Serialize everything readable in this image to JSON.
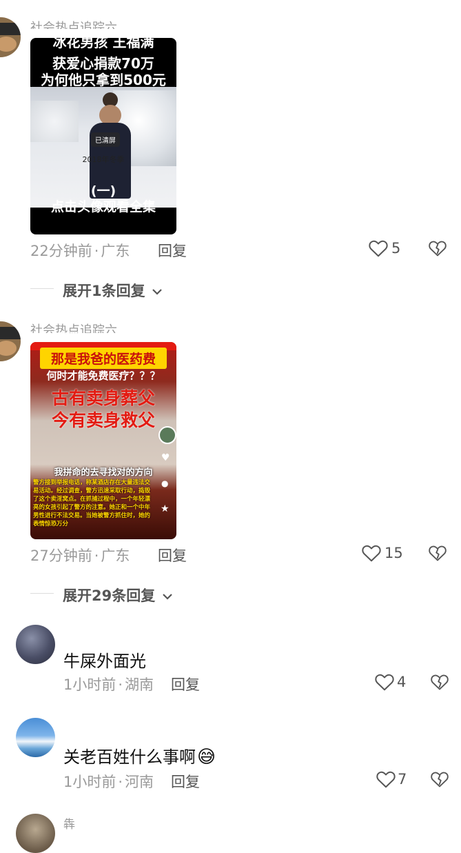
{
  "comments": [
    {
      "username": "社会热点追踪六",
      "video": {
        "line1": "冰花男孩 王福满",
        "line2": "获爱心捐款70万",
        "line3": "为何他只拿到500元",
        "clear_badge": "已清屏",
        "caption": "2018年冬季",
        "bottom1": "(一)",
        "bottom2": "点击头像观看全集"
      },
      "time": "22分钟前",
      "location": "广东",
      "reply_label": "回复",
      "likes": "5",
      "expand": "展开1条回复"
    },
    {
      "username": "社会热点追踪六",
      "video": {
        "top1": "那是我爸的医药费",
        "top2": "何时才能免费医疗？？？",
        "big1": "古有卖身葬父",
        "big2": "今有卖身救父",
        "mid": "我拼命的去寻找对的方向",
        "small": "警方接到举报电话，称某酒店存在大量违法交易活动。经过调查，警方迅速采取行动，捣毁了这个卖淫窝点。在抓捕过程中，一个年轻漂亮的女孩引起了警方的注意。她正和一个中年男性进行不法交易。当她被警方抓住时，她的表情惊恐万分"
      },
      "time": "27分钟前",
      "location": "广东",
      "reply_label": "回复",
      "likes": "15",
      "expand": "展开29条回复"
    },
    {
      "text": "牛屎外面光",
      "time": "1小时前",
      "location": "湖南",
      "reply_label": "回复",
      "likes": "4"
    },
    {
      "text": "关老百姓什么事啊",
      "emoji": "😅",
      "time": "1小时前",
      "location": "河南",
      "reply_label": "回复",
      "likes": "7"
    },
    {
      "username": "犇"
    }
  ],
  "separator": "·",
  "colors": {
    "meta": "#9a9a9a",
    "accent_red": "#d2231f",
    "yellow": "#ffd400"
  }
}
